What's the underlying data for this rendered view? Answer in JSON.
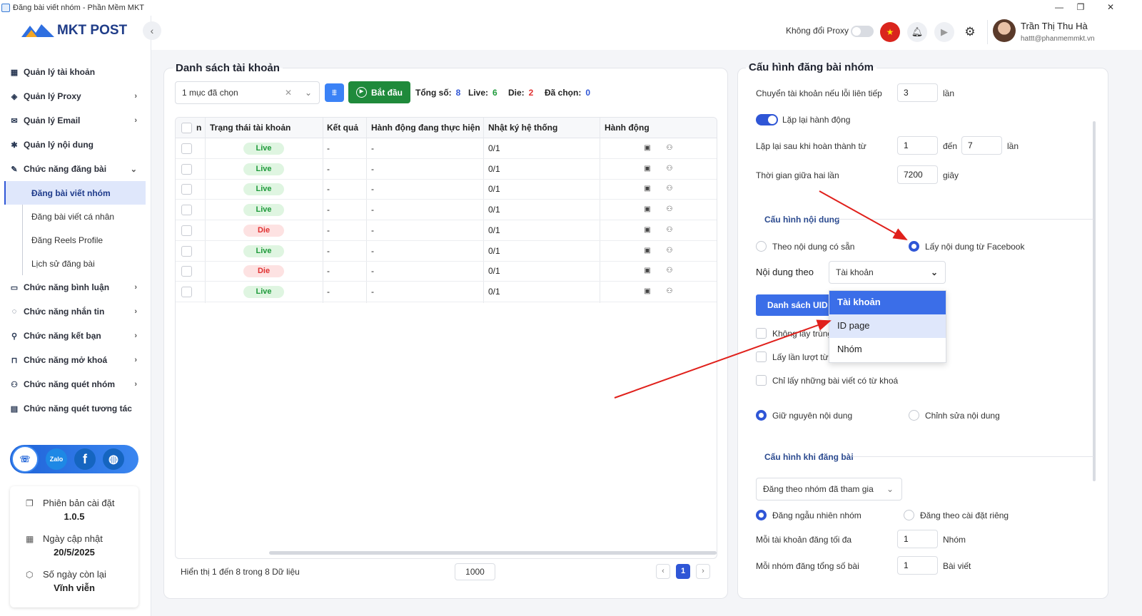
{
  "window": {
    "title": "Đăng bài viết nhóm - Phần Mềm MKT"
  },
  "logo": {
    "text": "MKT POST"
  },
  "sidebar": {
    "items": [
      {
        "label": "Quản lý tài khoản"
      },
      {
        "label": "Quản lý Proxy"
      },
      {
        "label": "Quản lý Email"
      },
      {
        "label": "Quản lý nội dung"
      },
      {
        "label": "Chức năng đăng bài"
      },
      {
        "label": "Đăng bài viết nhóm"
      },
      {
        "label": "Đăng bài viết cá nhân"
      },
      {
        "label": "Đăng Reels Profile"
      },
      {
        "label": "Lịch sử đăng bài"
      },
      {
        "label": "Chức năng bình luận"
      },
      {
        "label": "Chức năng nhắn tin"
      },
      {
        "label": "Chức năng kết bạn"
      },
      {
        "label": "Chức năng mở khoá"
      },
      {
        "label": "Chức năng quét nhóm"
      },
      {
        "label": "Chức năng quét tương tác"
      }
    ]
  },
  "social": {
    "zalo": "Zalo",
    "facebook": "f"
  },
  "info": {
    "version_label": "Phiên bản cài đặt",
    "version": "1.0.5",
    "updated_label": "Ngày cập nhật",
    "updated": "20/5/2025",
    "days_label": "Số ngày còn lại",
    "days": "Vĩnh viễn"
  },
  "header": {
    "proxy_label": "Không đổi Proxy",
    "user_name": "Trần Thị Thu Hà",
    "user_email": "hattt@phanmemmkt.vn"
  },
  "accounts": {
    "title": "Danh sách tài khoản",
    "select_value": "1 mục đã chọn",
    "start_label": "Bắt đầu",
    "total_label": "Tổng số:",
    "total": "8",
    "live_label": "Live:",
    "live": "6",
    "die_label": "Die:",
    "die": "2",
    "selected_label": "Đã chọn:",
    "selected": "0",
    "columns": [
      "n",
      "Trạng thái tài khoản",
      "Kết quả",
      "Hành động đang thực hiện",
      "Nhật ký hệ thống",
      "Hành động"
    ],
    "rows": [
      {
        "status": "Live",
        "result": "-",
        "action": "-",
        "log": "0/1"
      },
      {
        "status": "Live",
        "result": "-",
        "action": "-",
        "log": "0/1"
      },
      {
        "status": "Live",
        "result": "-",
        "action": "-",
        "log": "0/1"
      },
      {
        "status": "Live",
        "result": "-",
        "action": "-",
        "log": "0/1"
      },
      {
        "status": "Die",
        "result": "-",
        "action": "-",
        "log": "0/1"
      },
      {
        "status": "Live",
        "result": "-",
        "action": "-",
        "log": "0/1"
      },
      {
        "status": "Die",
        "result": "-",
        "action": "-",
        "log": "0/1"
      },
      {
        "status": "Live",
        "result": "-",
        "action": "-",
        "log": "0/1"
      }
    ],
    "footer": "Hiển thị 1 đến 8 trong 8 Dữ liệu",
    "page_size": "1000",
    "page": "1"
  },
  "config": {
    "title": "Cấu hình đăng bài nhóm",
    "switch_label": "Chuyển tài khoản nếu lỗi liên tiếp",
    "switch_value": "3",
    "times": "lần",
    "repeat_label": "Lặp lại hành động",
    "repeat_after_label": "Lặp lại sau khi hoàn thành từ",
    "repeat_from": "1",
    "to": "đến",
    "repeat_to": "7",
    "times2": "lần",
    "interval_label": "Thời gian giữa hai lần",
    "interval": "7200",
    "seconds": "giây",
    "content_section": "Cấu hình nội dung",
    "opt_available": "Theo nội dung có sẵn",
    "opt_facebook": "Lấy nội dung từ Facebook",
    "content_by_label": "Nội dung theo",
    "content_by_value": "Tài khoản",
    "uid_button": "Danh sách UID tài khoản",
    "dropdown": [
      "Tài khoản",
      "ID page",
      "Nhóm"
    ],
    "chk1": "Không lấy trùng",
    "chk2": "Lấy lần lượt từ bài",
    "chk3": "Chỉ lấy những bài viết có từ khoá",
    "keep_content": "Giữ nguyên nội dung",
    "edit_content": "Chỉnh sửa nội dung",
    "post_section": "Cấu hình khi đăng bài",
    "post_mode": "Đăng theo nhóm đã tham gia",
    "random_group": "Đăng ngẫu nhiên nhóm",
    "custom": "Đăng theo cài đặt riêng",
    "max_label": "Mỗi tài khoản đăng tối đa",
    "max_value": "1",
    "group_unit": "Nhóm",
    "total_label": "Mỗi nhóm đăng tổng số bài",
    "total_value": "1",
    "post_unit": "Bài viết"
  }
}
